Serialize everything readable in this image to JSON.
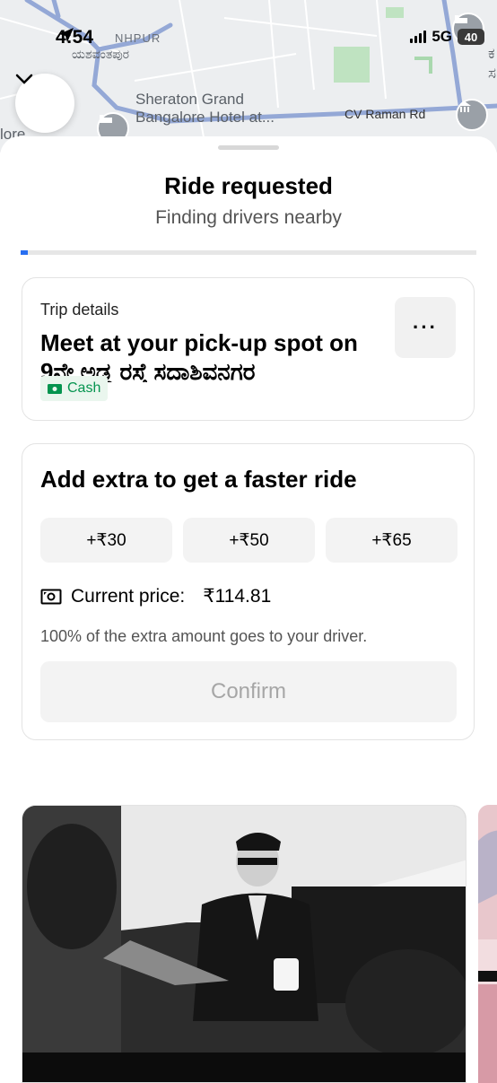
{
  "status_bar": {
    "time": "4:54",
    "network": "5G",
    "battery": "40"
  },
  "map": {
    "labels": {
      "area_top": "NHPUR",
      "area_kannada": "ಯಶವಂತಪುರ",
      "hotel": "Sheraton Grand\nBangalore Hotel at...",
      "road": "CV Raman Rd",
      "edge_left": "lore",
      "edge_right_1": "ಕ",
      "edge_right_2": "ಸ"
    }
  },
  "sheet": {
    "title": "Ride requested",
    "subtitle": "Finding drivers nearby",
    "progress": 0.015
  },
  "trip": {
    "label": "Trip details",
    "main": "Meet at your pick-up spot on 9ನೇ ಅಡ್ಡ ರಸ್ತೆ ಸದಾಶಿವನಗರ",
    "payment": "Cash",
    "more": "···"
  },
  "extra": {
    "title": "Add extra to get a faster ride",
    "options": [
      "+₹30",
      "+₹50",
      "+₹65"
    ],
    "price_label": "Current price:",
    "price_value": "₹114.81",
    "note": "100% of the extra amount goes to your driver.",
    "confirm": "Confirm"
  },
  "colors": {
    "accent": "#276ef1",
    "cash_green": "#05944f",
    "disabled_text": "#a6a6a6"
  },
  "icons": [
    "location-arrow-icon",
    "signal-icon",
    "chevron-down-icon",
    "hotel-icon",
    "bank-icon",
    "cash-icon",
    "money-icon",
    "more-icon"
  ]
}
